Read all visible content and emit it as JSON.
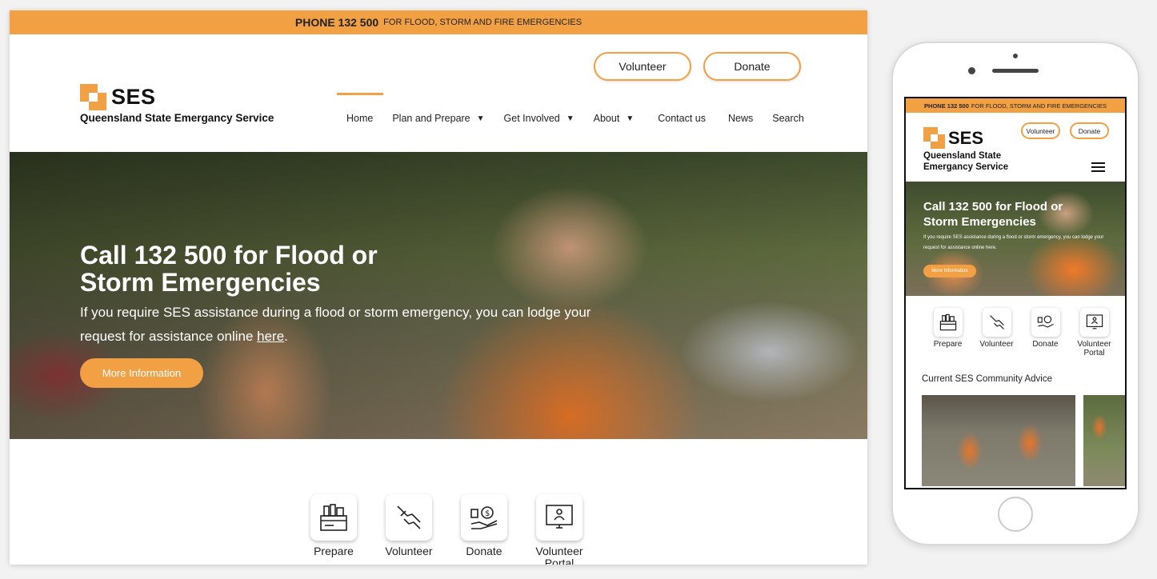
{
  "desktop": {
    "topbar": {
      "phone": "PHONE 132 500",
      "text": "FOR FLOOD, STORM AND FIRE EMERGENCIES"
    },
    "logo": {
      "name": "SES",
      "subtitle": "Queensland State Emergancy Service"
    },
    "cta": {
      "volunteer": "Volunteer",
      "donate": "Donate"
    },
    "nav": [
      {
        "label": "Home",
        "active": true
      },
      {
        "label": "Plan and Prepare",
        "dropdown": true
      },
      {
        "label": "Get Involved",
        "dropdown": true
      },
      {
        "label": "About",
        "dropdown": true
      },
      {
        "label": "Contact us"
      },
      {
        "label": "News"
      },
      {
        "label": "Search"
      }
    ],
    "hero": {
      "title": "Call 132 500 for Flood or Storm Emergencies",
      "text_before": "If you require SES assistance during a flood or storm emergency, you can lodge your request for assistance online ",
      "link": "here",
      "text_after": ".",
      "button": "More Information"
    },
    "quick_links": [
      {
        "label": "Prepare",
        "icon": "toolbox-icon"
      },
      {
        "label": "Volunteer",
        "icon": "helping-hands-icon"
      },
      {
        "label": "Donate",
        "icon": "donate-hand-icon"
      },
      {
        "label": "Volunteer Portal",
        "icon": "portal-monitor-icon"
      }
    ]
  },
  "mobile": {
    "topbar": {
      "phone": "PHONE 132 500",
      "text": "FOR FLOOD, STORM AND FIRE EMERGENCIES"
    },
    "logo": {
      "name": "SES",
      "subtitle": "Queensland State Emergancy Service"
    },
    "cta": {
      "volunteer": "Volunteer",
      "donate": "Donate"
    },
    "hero": {
      "title": "Call 132 500 for Flood or Storm Emergencies",
      "text": "If you require SES assistance during a flood or storm emergency, you can lodge your request for assistance online here.",
      "button": "More Information"
    },
    "quick_links": [
      {
        "label": "Prepare"
      },
      {
        "label": "Volunteer"
      },
      {
        "label": "Donate"
      },
      {
        "label": "Volunteer Portal"
      }
    ],
    "advice_title": "Current SES Community Advice"
  },
  "colors": {
    "accent": "#f2a044",
    "text": "#222222"
  }
}
